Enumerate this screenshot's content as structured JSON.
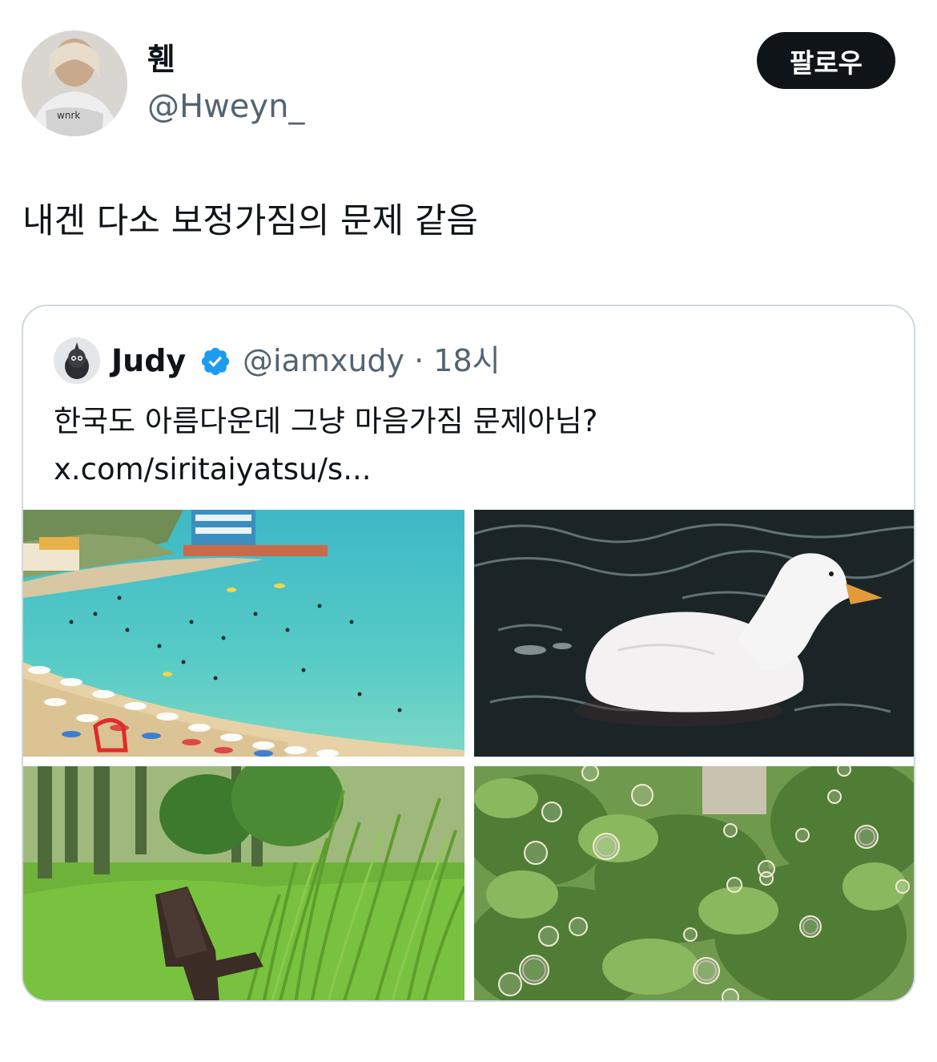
{
  "author": {
    "display_name": "휀",
    "handle": "@Hweyn_",
    "avatar_icon": "profile-photo"
  },
  "follow_button": {
    "label": "팔로우"
  },
  "tweet": {
    "text": "내겐 다소 보정가짐의 문제 같음"
  },
  "quoted_tweet": {
    "display_name": "Judy",
    "verified_icon": "verified-badge-icon",
    "meta": "@iamxudy · 18시",
    "text": "한국도 아름다운데 그냥 마음가짐 문제아님? x.com/siritaiyatsu/s...",
    "photos": [
      {
        "subject": "beach"
      },
      {
        "subject": "duck"
      },
      {
        "subject": "park-bench"
      },
      {
        "subject": "bubbles"
      }
    ]
  },
  "colors": {
    "text_primary": "#0f1419",
    "text_secondary": "#536471",
    "border": "#cfd9de",
    "verified_blue": "#1d9bf0",
    "button_bg": "#0f1419"
  }
}
